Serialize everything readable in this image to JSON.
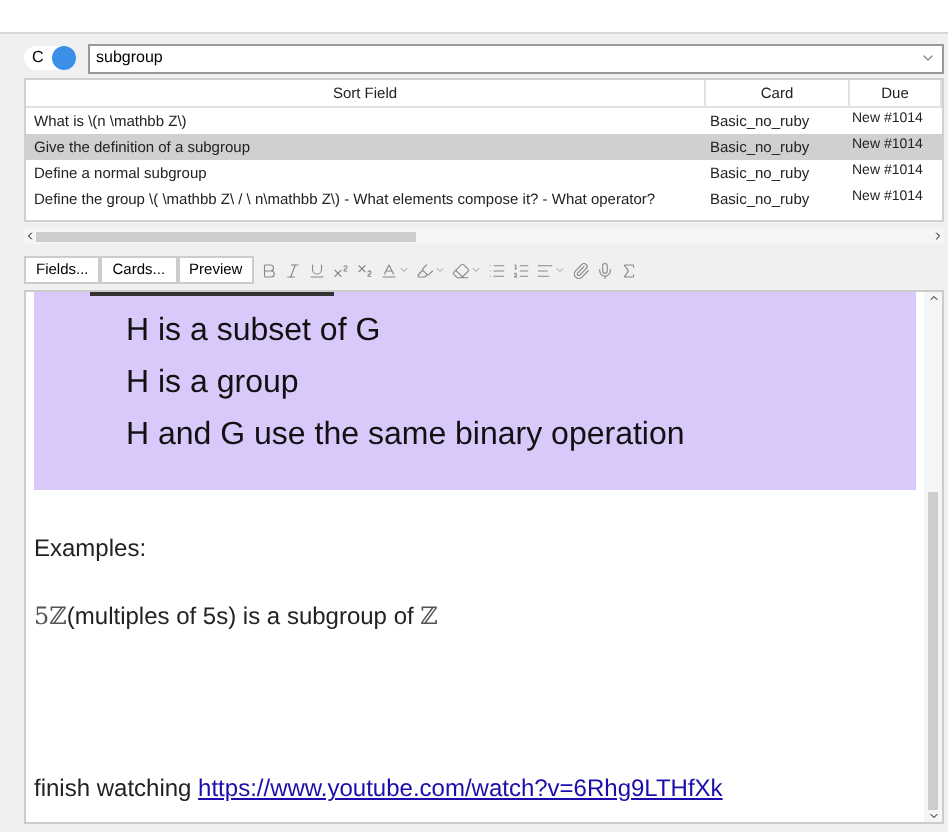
{
  "search": {
    "mode_label": "C",
    "mode_on": true,
    "value": "subgroup"
  },
  "table": {
    "columns": [
      "Sort Field",
      "Card",
      "Due"
    ],
    "rows": [
      {
        "cells": [
          "What is \\(n \\mathbb Z\\)",
          "Basic_no_ruby",
          "New #1014"
        ],
        "selected": false
      },
      {
        "cells": [
          "Give the definition of a subgroup",
          "Basic_no_ruby",
          "New #1014"
        ],
        "selected": true
      },
      {
        "cells": [
          "Define a normal subgroup",
          "Basic_no_ruby",
          "New #1014"
        ],
        "selected": false
      },
      {
        "cells": [
          "Define the group \\( \\mathbb Z\\  / \\ n\\mathbb Z\\) - What elements compose it? - What operator?",
          "Basic_no_ruby",
          "New #1014"
        ],
        "selected": false
      }
    ]
  },
  "toolbar": {
    "buttons": [
      "Fields...",
      "Cards...",
      "Preview"
    ]
  },
  "editor": {
    "highlight_lines": [
      "H is a subset of G",
      "H is a group",
      "H and G use the same binary operation"
    ],
    "examples_label": "Examples:",
    "example": {
      "math_prefix": "5ℤ",
      "text": "(multiples of 5s) is a subgroup of ",
      "math_suffix": "ℤ"
    },
    "note": {
      "text": "finish watching ",
      "link": "https://www.youtube.com/watch?v=6Rhg9LTHfXk"
    }
  }
}
